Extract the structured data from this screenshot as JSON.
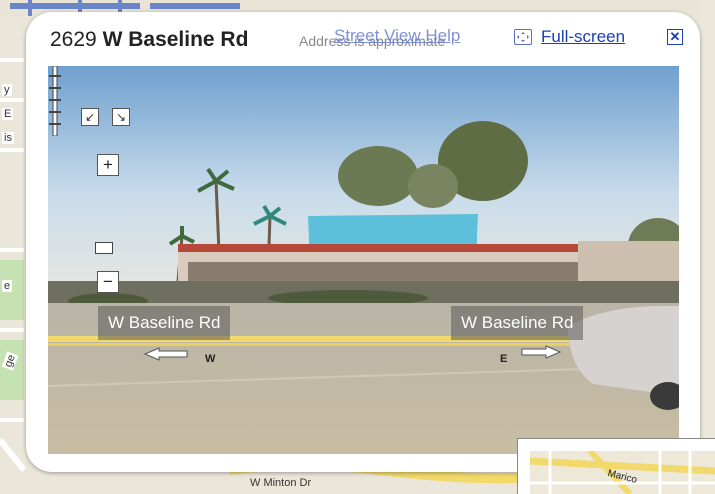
{
  "map": {
    "edge_labels": [
      "y",
      "E",
      "is",
      "e",
      "ge"
    ],
    "road_label": "W Minton Dr"
  },
  "info_window": {
    "address_number": "2629",
    "address_street": "W Baseline Rd",
    "approx_note": "Address is approximate",
    "street_view_help": "Street View Help",
    "fullscreen_label": "Full-screen",
    "close_glyph": "✕"
  },
  "panorama": {
    "pan_left_glyph": "↙",
    "pan_right_glyph": "↘",
    "zoom_in_glyph": "+",
    "zoom_out_glyph": "−",
    "street_label_left": "W Baseline Rd",
    "street_label_right": "W Baseline Rd",
    "direction_west": "W",
    "direction_east": "E"
  },
  "minimap": {
    "label": "Marico"
  },
  "colors": {
    "link": "#1a3fb8",
    "road_yellow": "#f2d96b",
    "map_bg": "#e8e4da"
  },
  "icons": {
    "fullscreen": "fullscreen-icon",
    "close": "close-icon",
    "pan_left": "pan-left-icon",
    "pan_right": "pan-right-icon",
    "zoom_in": "zoom-in-icon",
    "zoom_out": "zoom-out-icon"
  }
}
